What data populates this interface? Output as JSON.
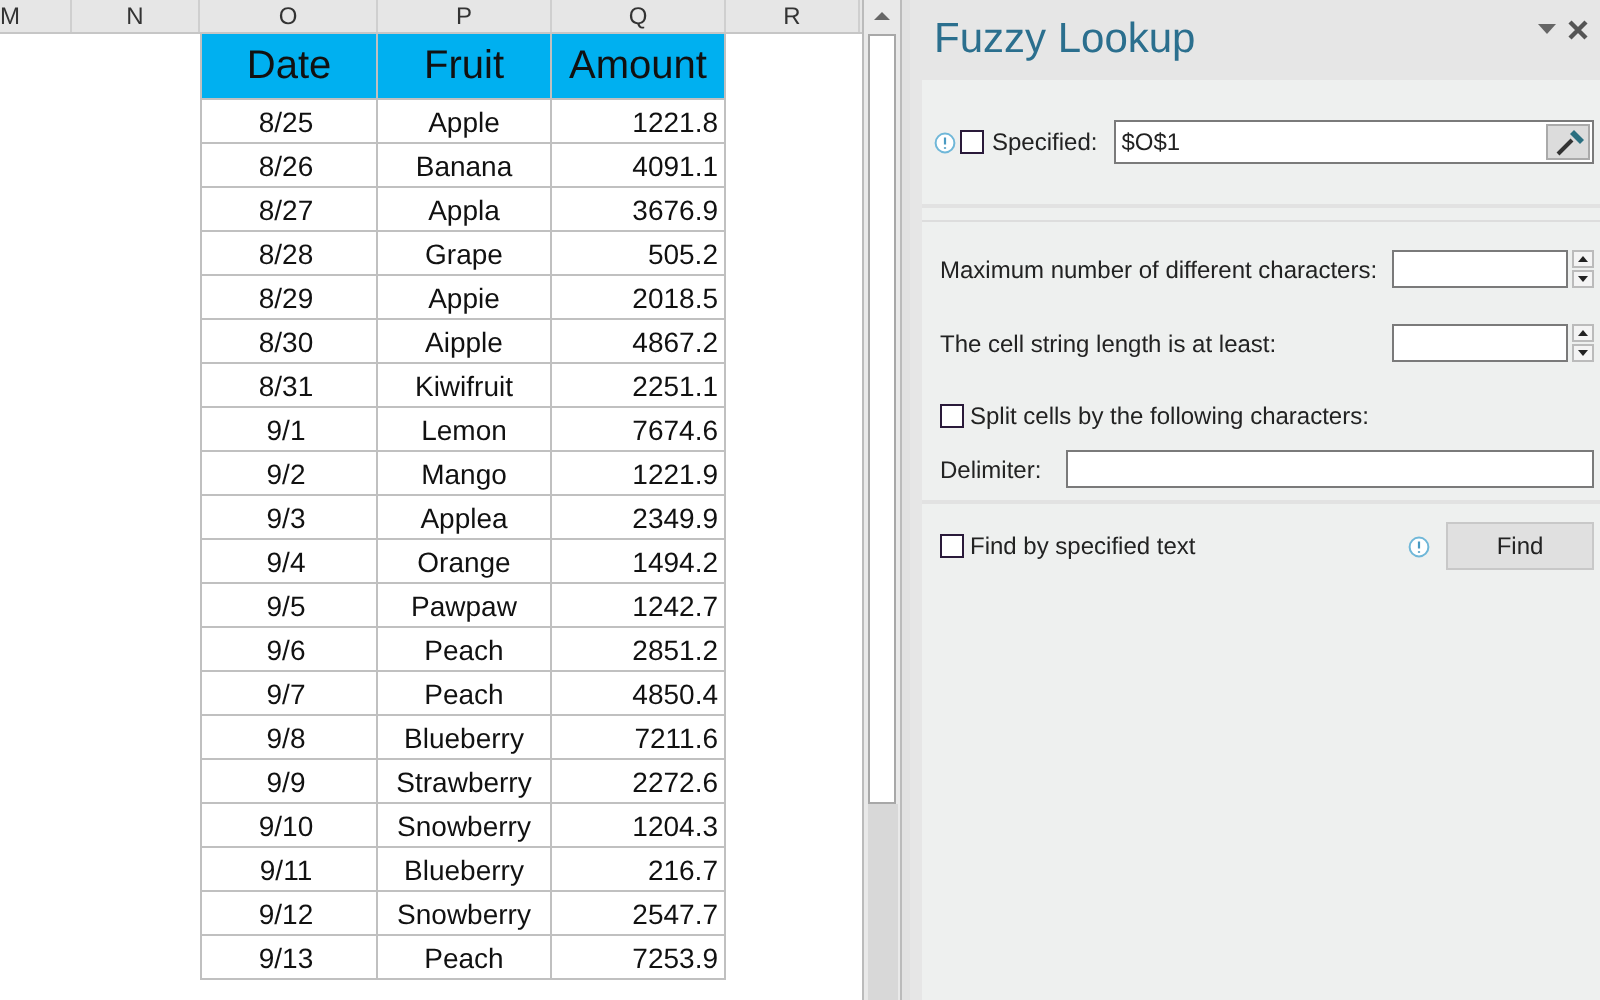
{
  "sheet": {
    "column_headers": [
      "M",
      "N",
      "O",
      "P",
      "Q",
      "R"
    ],
    "table": {
      "columns": [
        "Date",
        "Fruit",
        "Amount"
      ],
      "rows": [
        [
          "8/25",
          "Apple",
          "1221.8"
        ],
        [
          "8/26",
          "Banana",
          "4091.1"
        ],
        [
          "8/27",
          "Appla",
          "3676.9"
        ],
        [
          "8/28",
          "Grape",
          "505.2"
        ],
        [
          "8/29",
          "Appie",
          "2018.5"
        ],
        [
          "8/30",
          "Aipple",
          "4867.2"
        ],
        [
          "8/31",
          "Kiwifruit",
          "2251.1"
        ],
        [
          "9/1",
          "Lemon",
          "7674.6"
        ],
        [
          "9/2",
          "Mango",
          "1221.9"
        ],
        [
          "9/3",
          "Applea",
          "2349.9"
        ],
        [
          "9/4",
          "Orange",
          "1494.2"
        ],
        [
          "9/5",
          "Pawpaw",
          "1242.7"
        ],
        [
          "9/6",
          "Peach",
          "2851.2"
        ],
        [
          "9/7",
          "Peach",
          "4850.4"
        ],
        [
          "9/8",
          "Blueberry",
          "7211.6"
        ],
        [
          "9/9",
          "Strawberry",
          "2272.6"
        ],
        [
          "9/10",
          "Snowberry",
          "1204.3"
        ],
        [
          "9/11",
          "Blueberry",
          "216.7"
        ],
        [
          "9/12",
          "Snowberry",
          "2547.7"
        ],
        [
          "9/13",
          "Peach",
          "7253.9"
        ]
      ]
    }
  },
  "pane": {
    "title": "Fuzzy Lookup",
    "specified": {
      "label": "Specified:",
      "checked": false,
      "value": "$O$1"
    },
    "max_different": {
      "label": "Maximum number of different characters:"
    },
    "min_length": {
      "label": "The cell string length is at least:"
    },
    "split": {
      "label": "Split cells by the following characters:",
      "checked": false
    },
    "delimiter": {
      "label": "Delimiter:"
    },
    "find_by_text": {
      "label": "Find by specified text",
      "checked": false
    },
    "find_button": "Find"
  }
}
